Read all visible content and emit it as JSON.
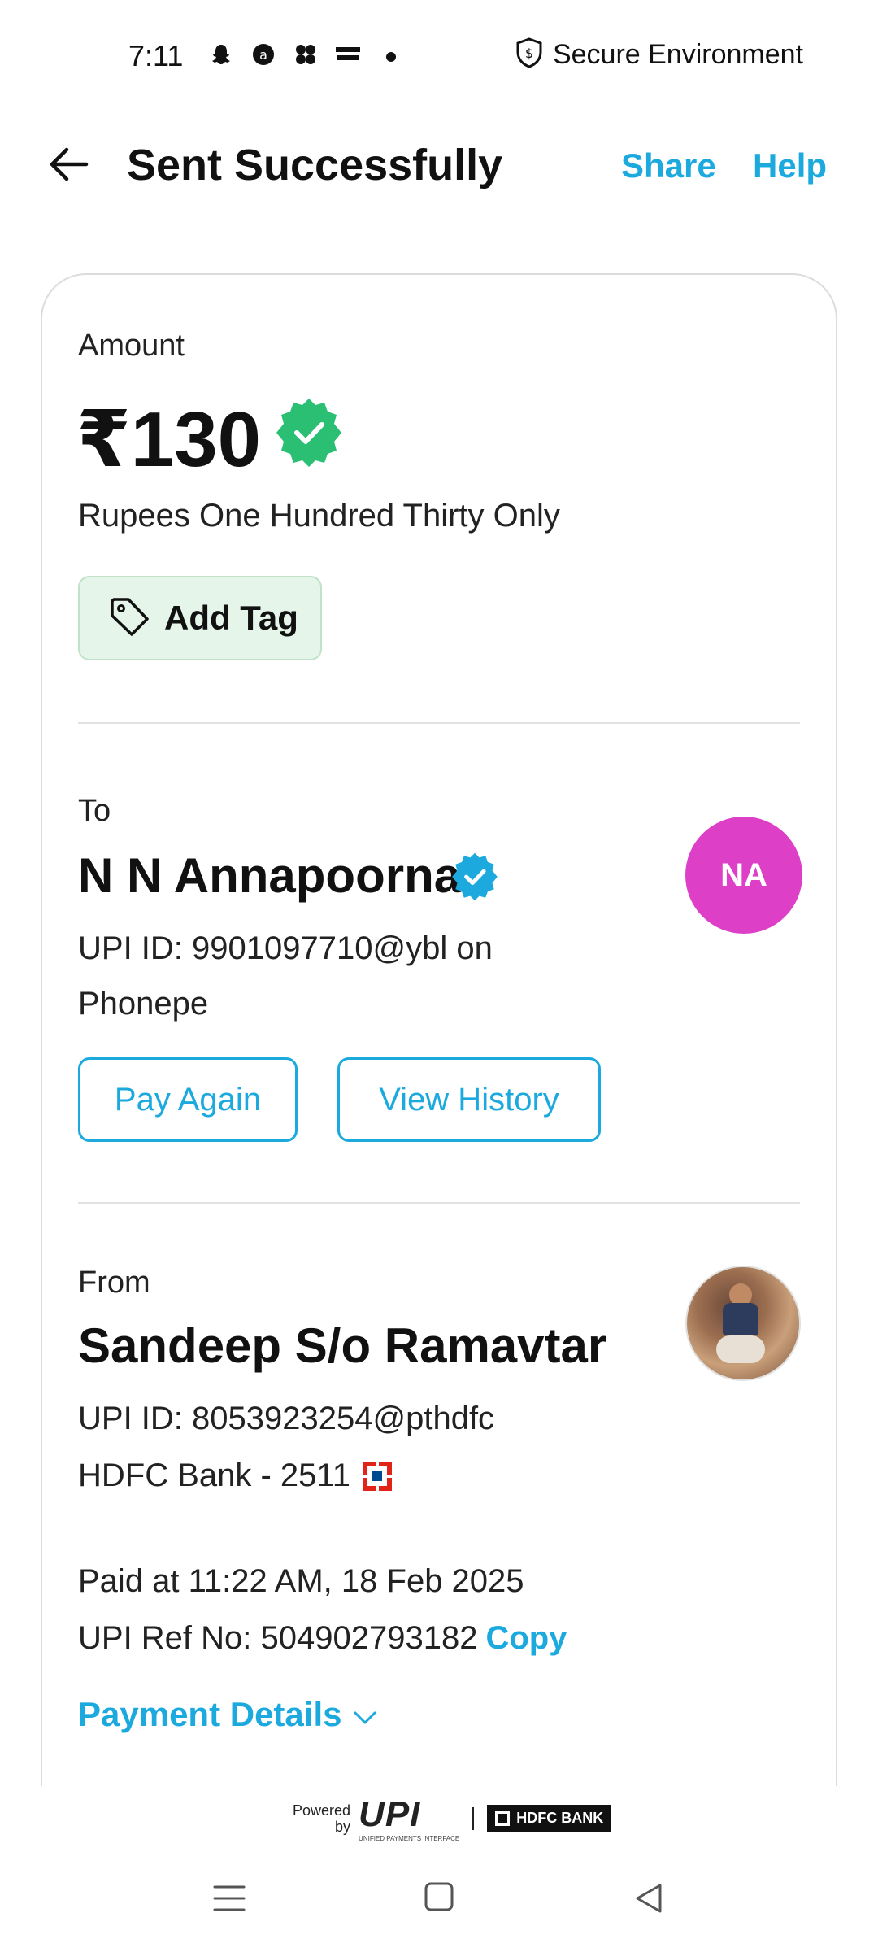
{
  "status_bar": {
    "time": "7:11",
    "secure_text": "Secure Environment",
    "icons": [
      "snapchat-icon",
      "app-icon",
      "app-grid-icon",
      "news-icon"
    ]
  },
  "header": {
    "title": "Sent Successfully",
    "share": "Share",
    "help": "Help"
  },
  "amount": {
    "label": "Amount",
    "value": "₹130",
    "words": "Rupees One Hundred Thirty Only",
    "add_tag": "Add Tag"
  },
  "to": {
    "label": "To",
    "name": "N N Annapoorna",
    "upi": "UPI ID: 9901097710@ybl on Phonepe",
    "initials": "NA",
    "avatar_color": "#dd3fc6",
    "pay_again": "Pay Again",
    "view_history": "View History"
  },
  "from": {
    "label": "From",
    "name": "Sandeep S/o Ramavtar",
    "upi": "UPI ID: 8053923254@pthdfc",
    "bank": "HDFC Bank - 2511"
  },
  "transaction": {
    "paid_at": "Paid at 11:22 AM, 18 Feb 2025",
    "ref": "UPI Ref No: 504902793182",
    "copy": "Copy",
    "payment_details": "Payment Details"
  },
  "footer": {
    "powered_line1": "Powered",
    "powered_line2": "by",
    "upi_logo": "UPI",
    "upi_sub": "UNIFIED PAYMENTS INTERFACE",
    "hdfc_logo": "HDFC BANK"
  },
  "colors": {
    "accent": "#1ba9de",
    "success": "#2bbf74",
    "verified": "#1ba9de"
  }
}
